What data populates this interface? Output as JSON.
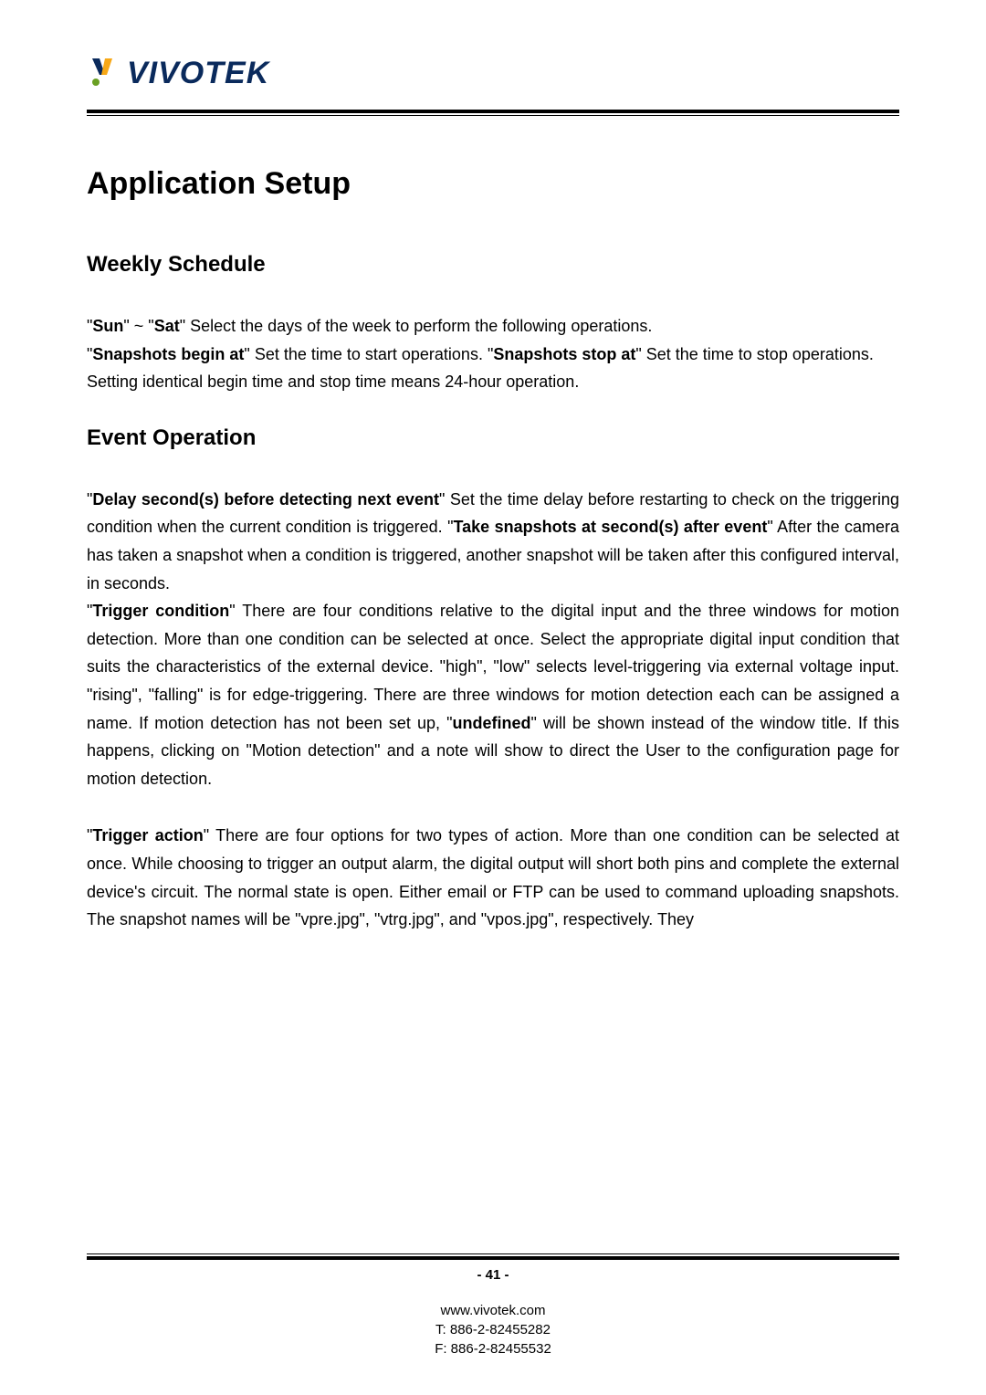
{
  "logo": {
    "text": "VIVOTEK"
  },
  "title": "Application Setup",
  "section1": {
    "heading": "Weekly Schedule",
    "sun": "Sun",
    "tilde": "~",
    "sat": "Sat",
    "txt1": " Select the days of the week to perform the following operations.",
    "snap_begin": "Snapshots begin at",
    "txt2": " Set the time to start operations. \"",
    "snap_stop": "Snapshots stop at",
    "txt3": "\" Set the time to stop operations.",
    "txt4": "Setting identical begin time and stop time means 24-hour operation."
  },
  "section2": {
    "heading": "Event Operation",
    "delay": "Delay second(s) before detecting next event",
    "delay_txt": " Set the time delay before restarting to check on the triggering condition when the current condition is triggered.",
    "take": "Take snapshots at second(s) after event",
    "take_txt": " After the camera has taken a snapshot when a condition is triggered, another snapshot will be taken after this configured interval, in seconds.",
    "trig_cond": "Trigger condition",
    "trig_cond_txt1": " There are four conditions relative to the digital input and the three windows for motion detection. More than one condition can be selected at once. Select the appropriate digital input condition that suits the characteristics of the external device. \"high\", \"low\" selects level-triggering via  external voltage input. \"rising\", \"falling\" is for edge-triggering. There are three windows for motion detection each can be assigned a name. If motion detection has not been set up, \"",
    "undefined": "undefined",
    "trig_cond_txt2": "\" will be shown instead of the window title. If this happens, clicking on \"Motion detection\" and a note will show to direct the User to the configuration page for motion detection.",
    "trig_action": "Trigger action",
    "trig_action_txt": " There are four options for two types of action. More than one condition can be selected at once. While choosing to trigger an output alarm, the digital output will short both pins and complete the external device's circuit.  The normal state is open. Either email or FTP can be used to command uploading snapshots. The snapshot names will be \"vpre.jpg\", \"vtrg.jpg\", and \"vpos.jpg\", respectively.  They"
  },
  "footer": {
    "page": "- 41 -",
    "url": "www.vivotek.com",
    "tel": "T: 886-2-82455282",
    "fax": "F: 886-2-82455532"
  }
}
